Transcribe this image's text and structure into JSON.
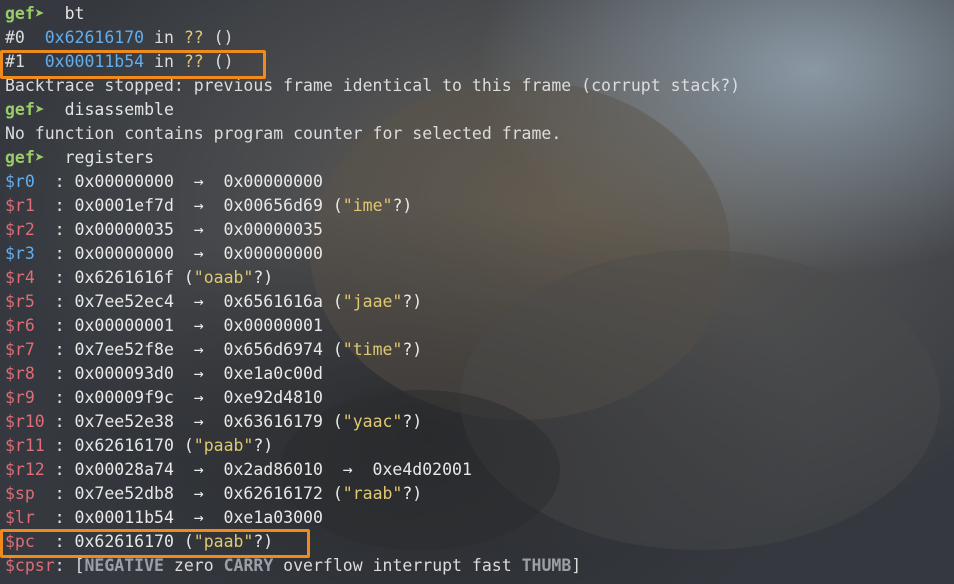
{
  "prompt_sym": "gef➤ ",
  "colors": {
    "highlight": "#f08a1c",
    "prompt": "#9acd68",
    "address": "#62aeef",
    "unknown": "#e0c870",
    "register_changed": "#e06c75",
    "register_unchanged": "#62aeef"
  },
  "bt": {
    "cmd": " bt",
    "frame0": {
      "num": "#0  ",
      "addr": "0x62616170",
      "in": " in ",
      "sym": "??",
      "args": " ()"
    },
    "frame1": {
      "num": "#1  ",
      "addr": "0x00011b54",
      "in": " in ",
      "sym": "??",
      "args": " ()"
    },
    "stopped": "Backtrace stopped: previous frame identical to this frame (corrupt stack?)"
  },
  "disasm": {
    "cmd": " disassemble",
    "output": "No function contains program counter for selected frame."
  },
  "regs_cmd": " registers",
  "regs": [
    {
      "name": "$r0  ",
      "sep": ": ",
      "chain": "0x00000000  →  0x00000000",
      "str": "",
      "tail": ""
    },
    {
      "name": "$r1  ",
      "sep": ": ",
      "chain": "0x0001ef7d  →  0x00656d69 (",
      "str": "\"ime\"",
      "tail": "?)"
    },
    {
      "name": "$r2  ",
      "sep": ": ",
      "chain": "0x00000035  →  0x00000035",
      "str": "",
      "tail": ""
    },
    {
      "name": "$r3  ",
      "sep": ": ",
      "chain": "0x00000000  →  0x00000000",
      "str": "",
      "tail": ""
    },
    {
      "name": "$r4  ",
      "sep": ": ",
      "chain": "0x6261616f (",
      "str": "\"oaab\"",
      "tail": "?)"
    },
    {
      "name": "$r5  ",
      "sep": ": ",
      "chain": "0x7ee52ec4  →  0x6561616a (",
      "str": "\"jaae\"",
      "tail": "?)"
    },
    {
      "name": "$r6  ",
      "sep": ": ",
      "chain": "0x00000001  →  0x00000001",
      "str": "",
      "tail": ""
    },
    {
      "name": "$r7  ",
      "sep": ": ",
      "chain": "0x7ee52f8e  →  0x656d6974 (",
      "str": "\"time\"",
      "tail": "?)"
    },
    {
      "name": "$r8  ",
      "sep": ": ",
      "chain": "0x000093d0  →  0xe1a0c00d",
      "str": "",
      "tail": ""
    },
    {
      "name": "$r9  ",
      "sep": ": ",
      "chain": "0x00009f9c  →  0xe92d4810",
      "str": "",
      "tail": ""
    },
    {
      "name": "$r10 ",
      "sep": ": ",
      "chain": "0x7ee52e38  →  0x63616179 (",
      "str": "\"yaac\"",
      "tail": "?)"
    },
    {
      "name": "$r11 ",
      "sep": ": ",
      "chain": "0x62616170 (",
      "str": "\"paab\"",
      "tail": "?)"
    },
    {
      "name": "$r12 ",
      "sep": ": ",
      "chain": "0x00028a74  →  0x2ad86010  →  0xe4d02001",
      "str": "",
      "tail": ""
    },
    {
      "name": "$sp  ",
      "sep": ": ",
      "chain": "0x7ee52db8  →  0x62616172 (",
      "str": "\"raab\"",
      "tail": "?)"
    },
    {
      "name": "$lr  ",
      "sep": ": ",
      "chain": "0x00011b54  →  0xe1a03000",
      "str": "",
      "tail": ""
    },
    {
      "name": "$pc  ",
      "sep": ": ",
      "chain": "0x62616170 (",
      "str": "\"paab\"",
      "tail": "?)"
    }
  ],
  "cpsr": {
    "name": "$cpsr",
    "sep": ": [",
    "f1": "NEGATIVE",
    "f2": " zero ",
    "f3": "CARRY",
    "f4": " overflow interrupt fast ",
    "f5": "THUMB",
    "end": "]"
  }
}
